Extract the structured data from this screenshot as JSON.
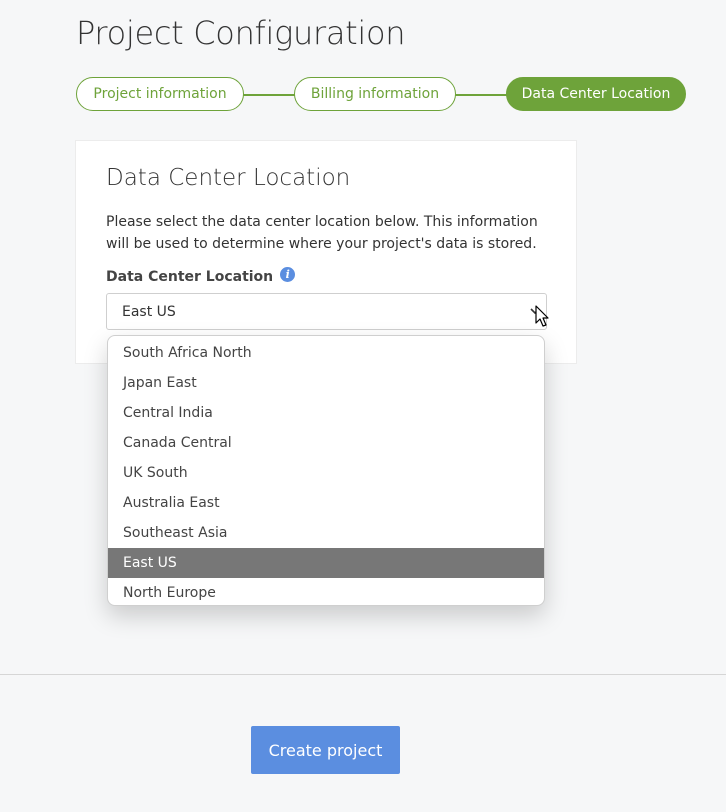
{
  "page": {
    "title": "Project Configuration"
  },
  "stepper": {
    "steps": [
      {
        "label": "Project information",
        "active": false
      },
      {
        "label": "Billing information",
        "active": false
      },
      {
        "label": "Data Center Location",
        "active": true
      }
    ],
    "accent_color": "#6ea33a"
  },
  "card": {
    "title": "Data Center Location",
    "description": "Please select the data center location below. This information will be used to determine where your project's data is stored.",
    "field_label": "Data Center Location",
    "info_icon": "info-icon",
    "select_value": "East US"
  },
  "dropdown": {
    "options": [
      "South Africa North",
      "Japan East",
      "Central India",
      "Canada Central",
      "UK South",
      "Australia East",
      "Southeast Asia",
      "East US",
      "North Europe"
    ],
    "selected": "East US",
    "selected_color": "#777777"
  },
  "footer": {
    "create_label": "Create project",
    "button_color": "#5b8ee0"
  }
}
